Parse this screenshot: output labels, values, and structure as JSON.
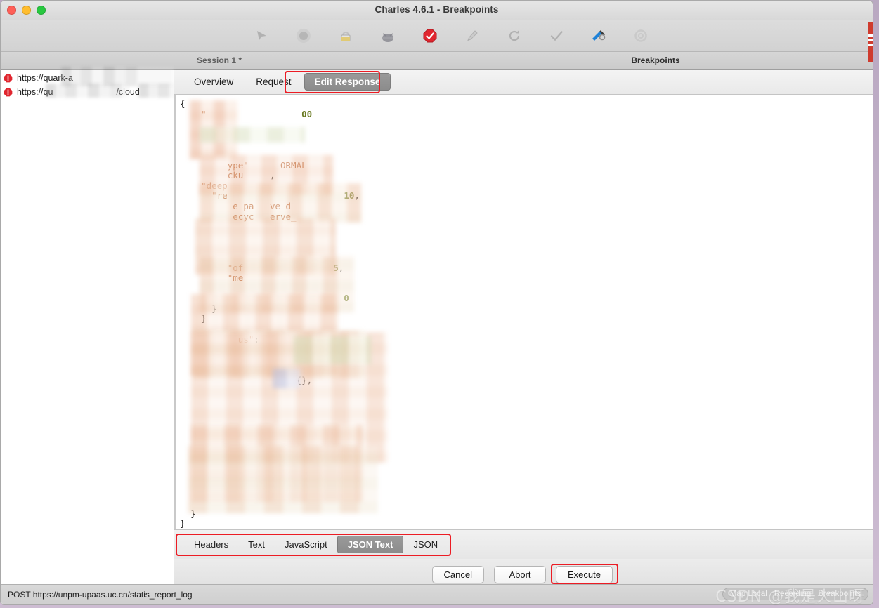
{
  "window": {
    "title": "Charles 4.6.1 - Breakpoints",
    "traffic_lights": [
      "close-red",
      "minimize-yellow",
      "zoom-green"
    ]
  },
  "toolbar": {
    "icons": [
      {
        "name": "cursor-arrow-icon",
        "label": "Select"
      },
      {
        "name": "record-circle-icon",
        "label": "Start/Stop Recording"
      },
      {
        "name": "throttle-icon",
        "label": "Throttling"
      },
      {
        "name": "breakpoints-bug-icon",
        "label": "Breakpoints"
      },
      {
        "name": "stop-sign-icon",
        "label": "Enable Breakpoints"
      },
      {
        "name": "clear-broom-icon",
        "label": "Clear Session"
      },
      {
        "name": "repeat-icon",
        "label": "Repeat"
      },
      {
        "name": "validate-check-icon",
        "label": "Validate"
      },
      {
        "name": "tools-icon",
        "label": "Tools"
      },
      {
        "name": "settings-gear-icon",
        "label": "Settings"
      }
    ]
  },
  "panes": {
    "session_tab": "Session 1 *",
    "breakpoints_tab": "Breakpoints"
  },
  "sidebar": {
    "breakpoint_rows": [
      {
        "icon": "breakpoint-stop-icon",
        "url": "https://quark-a"
      },
      {
        "icon": "breakpoint-stop-icon",
        "url_prefix": "https://qu",
        "url_suffix": "/cloud"
      }
    ]
  },
  "detail": {
    "tabs": [
      {
        "label": "Overview",
        "selected": false
      },
      {
        "label": "Request",
        "selected": false
      },
      {
        "label": "Edit Response",
        "selected": true
      }
    ],
    "highlight_color": "#ec1c24"
  },
  "editor": {
    "language": "json",
    "visible_tokens": [
      {
        "line": 1,
        "text": "{"
      },
      {
        "line": 2,
        "text": "\""
      },
      {
        "line": 2,
        "text": "00"
      },
      {
        "line": 8,
        "text": "ype\""
      },
      {
        "line": 8,
        "text": "ORMAL"
      },
      {
        "line": 9,
        "text": "cku"
      },
      {
        "line": 9,
        "text": ","
      },
      {
        "line": 10,
        "text": "\"deep"
      },
      {
        "line": 11,
        "text": "\"re"
      },
      {
        "line": 11,
        "text": "10,"
      },
      {
        "line": 12,
        "text": "e_pa"
      },
      {
        "line": 12,
        "text": "ve_d"
      },
      {
        "line": 13,
        "text": "ecyc"
      },
      {
        "line": 13,
        "text": "erve_"
      },
      {
        "line": 18,
        "text": "\"of"
      },
      {
        "line": 18,
        "text": "5,"
      },
      {
        "line": 19,
        "text": "\"me"
      },
      {
        "line": 21,
        "text": "0"
      },
      {
        "line": 22,
        "text": "}"
      },
      {
        "line": 23,
        "text": "}"
      },
      {
        "line": 25,
        "text": "us\":"
      },
      {
        "line": 29,
        "text": "{},"
      },
      {
        "line": 42,
        "text": "}"
      },
      {
        "line": 43,
        "text": "}"
      }
    ],
    "note": "response body content is blurred/redacted in the screenshot"
  },
  "format_tabs": [
    {
      "label": "Headers",
      "selected": false
    },
    {
      "label": "Text",
      "selected": false
    },
    {
      "label": "JavaScript",
      "selected": false
    },
    {
      "label": "JSON Text",
      "selected": true
    },
    {
      "label": "JSON",
      "selected": false
    }
  ],
  "actions": [
    {
      "label": "Cancel",
      "highlighted": false
    },
    {
      "label": "Abort",
      "highlighted": false
    },
    {
      "label": "Execute",
      "highlighted": true
    }
  ],
  "status": {
    "request_line": "POST https://unpm-upaas.uc.cn/statis_report_log",
    "indicators": [
      "Map Local",
      "Recording",
      "Breakpoints"
    ],
    "watermark": "CSDN @我是火山呀"
  }
}
